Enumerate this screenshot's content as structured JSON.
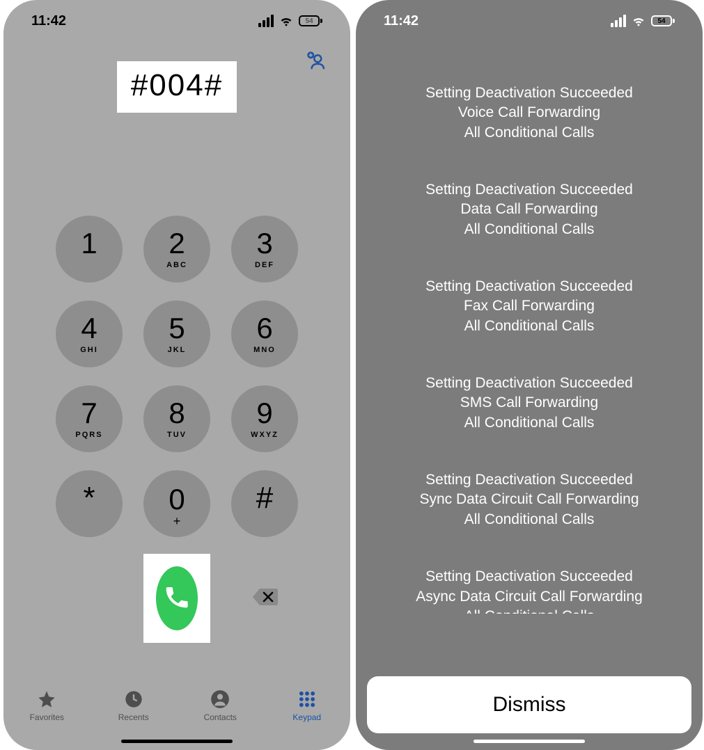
{
  "status": {
    "time": "11:42",
    "battery": "54"
  },
  "dialer": {
    "entered_code": "#004#",
    "keys": [
      {
        "digit": "1",
        "letters": ""
      },
      {
        "digit": "2",
        "letters": "ABC"
      },
      {
        "digit": "3",
        "letters": "DEF"
      },
      {
        "digit": "4",
        "letters": "GHI"
      },
      {
        "digit": "5",
        "letters": "JKL"
      },
      {
        "digit": "6",
        "letters": "MNO"
      },
      {
        "digit": "7",
        "letters": "PQRS"
      },
      {
        "digit": "8",
        "letters": "TUV"
      },
      {
        "digit": "9",
        "letters": "WXYZ"
      },
      {
        "digit": "*",
        "letters": ""
      },
      {
        "digit": "0",
        "letters": "+"
      },
      {
        "digit": "#",
        "letters": ""
      }
    ],
    "tabs": {
      "favorites": "Favorites",
      "recents": "Recents",
      "contacts": "Contacts",
      "keypad": "Keypad"
    }
  },
  "result": {
    "messages": [
      {
        "l1": "Setting Deactivation Succeeded",
        "l2": "Voice Call Forwarding",
        "l3": "All Conditional Calls"
      },
      {
        "l1": "Setting Deactivation Succeeded",
        "l2": "Data Call Forwarding",
        "l3": "All Conditional Calls"
      },
      {
        "l1": "Setting Deactivation Succeeded",
        "l2": "Fax Call Forwarding",
        "l3": "All Conditional Calls"
      },
      {
        "l1": "Setting Deactivation Succeeded",
        "l2": "SMS Call Forwarding",
        "l3": "All Conditional Calls"
      },
      {
        "l1": "Setting Deactivation Succeeded",
        "l2": "Sync Data Circuit Call Forwarding",
        "l3": "All Conditional Calls"
      },
      {
        "l1": "Setting Deactivation Succeeded",
        "l2": "Async Data Circuit Call Forwarding",
        "l3": "All Conditional Calls"
      }
    ],
    "dismiss": "Dismiss"
  }
}
